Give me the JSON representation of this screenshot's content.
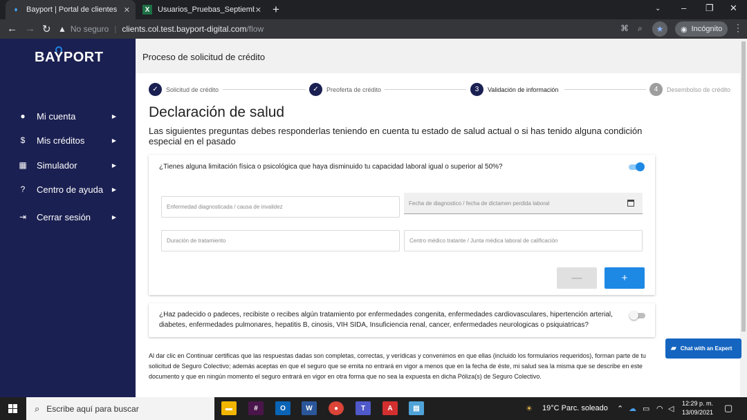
{
  "browser": {
    "tabs": [
      {
        "title": "Bayport | Portal de clientes",
        "icon": "bayport-favicon"
      },
      {
        "title": "Usuarios_Pruebas_Septiembre_O",
        "icon": "excel-icon"
      }
    ],
    "url_warning": "No seguro",
    "url_host": "clients.col.test.bayport-digital.com",
    "url_path": "/flow",
    "incognito_label": "Incógnito"
  },
  "sidebar": {
    "logo": "BAYPORT",
    "items": [
      {
        "label": "Mi cuenta",
        "icon": "person-icon"
      },
      {
        "label": "Mis créditos",
        "icon": "dollar-icon"
      },
      {
        "label": "Simulador",
        "icon": "calculator-icon"
      },
      {
        "label": "Centro de ayuda",
        "icon": "help-icon"
      },
      {
        "label": "Cerrar sesión",
        "icon": "logout-icon"
      }
    ]
  },
  "header": {
    "title": "Proceso de solicitud de crédito"
  },
  "stepper": [
    {
      "label": "Solicitud de crédito",
      "symbol": "✓",
      "state": "done"
    },
    {
      "label": "Preoferta de crédito",
      "symbol": "✓",
      "state": "done"
    },
    {
      "label": "Validación de información",
      "symbol": "3",
      "state": "current"
    },
    {
      "label": "Desembolso de crédito",
      "symbol": "4",
      "state": "pending"
    }
  ],
  "main": {
    "title": "Declaración de salud",
    "lead": "Las siguientes preguntas debes responderlas teniendo en cuenta tu estado de salud actual o si has tenido alguna condición especial en el pasado",
    "q1": {
      "text": "¿Tienes alguna limitación física o psicológica que haya disminuido tu capacidad laboral igual o superior al 50%?",
      "toggle": "on",
      "fields": {
        "disease": "Enfermedad diagnosticada / causa de invalidez",
        "date": "Fecha de diagnostico / fecha de dictamen perdida laboral",
        "duration": "Duración de tratamiento",
        "center": "Centro médico tratante / Junta médica laboral de calificación"
      },
      "minus_label": "—",
      "plus_label": "+"
    },
    "q2": {
      "text": "¿Haz padecido o padeces, recibiste o recibes algún tratamiento por enfermedades congenita, enfermedades cardiovasculares, hipertención arterial, diabetes, enfermedades pulmonares, hepatitis B, cinosis, VIH SIDA, Insuficiencia renal, cancer, enfermedades neurologicas o psiquiatricas?",
      "toggle": "off"
    },
    "legal": "Al dar clic en Continuar certificas que las respuestas dadas son completas, correctas, y verídicas y convenimos en que ellas (incluido los formularios requeridos), forman parte de tu solicitud de Seguro Colectivo; además aceptas en que el seguro que se emita no entrará en vigor a menos que en la fecha de éste, mi salud sea la misma que se describe en este documento y que en ningún momento el seguro entrará en vigor en otra forma que no sea la expuesta en dicha Póliza(s) de Seguro Colectivo."
  },
  "chat": {
    "label": "Chat with an Expert"
  },
  "taskbar": {
    "search_placeholder": "Escribe aquí para buscar",
    "weather": "19°C  Parc. soleado",
    "time": "12:29 p. m.",
    "date": "13/09/2021",
    "apps": [
      "file-explorer-icon",
      "slack-icon",
      "outlook-icon",
      "word-icon",
      "chrome-icon",
      "teams-icon",
      "acrobat-icon",
      "notepad-icon"
    ]
  }
}
